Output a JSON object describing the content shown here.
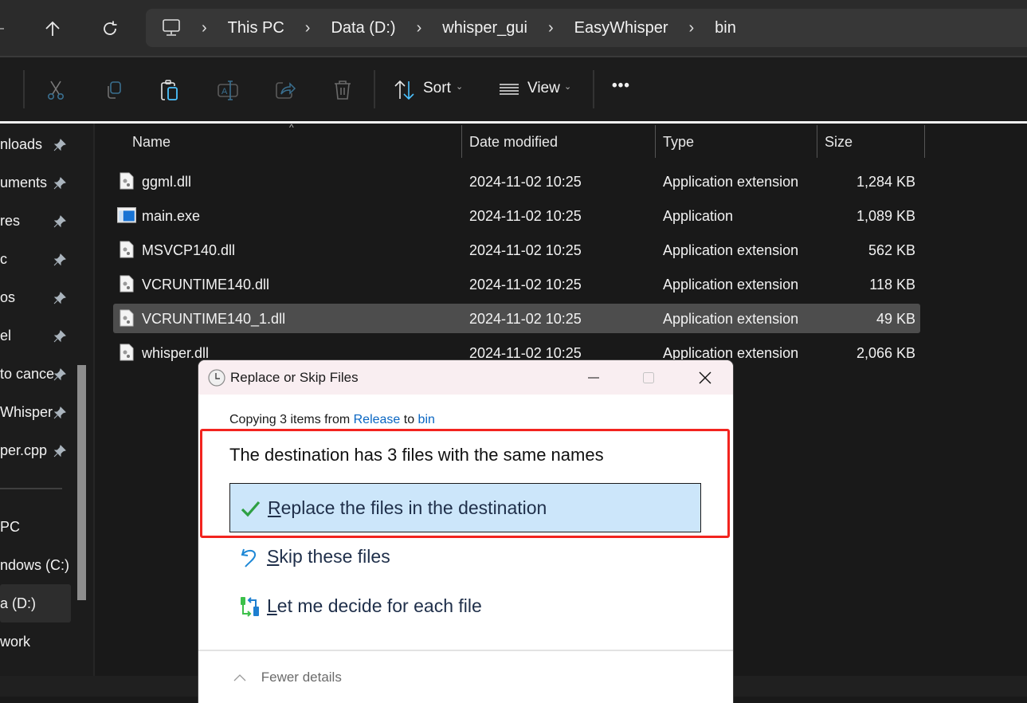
{
  "address_bar": {
    "breadcrumbs": [
      "This PC",
      "Data (D:)",
      "whisper_gui",
      "EasyWhisper",
      "bin"
    ],
    "icons": {
      "up": "arrow-up-icon",
      "refresh": "refresh-icon",
      "root": "computer-icon"
    }
  },
  "command_bar": {
    "icons": [
      "cut-icon",
      "copy-icon",
      "paste-icon",
      "rename-icon",
      "share-icon",
      "delete-icon"
    ],
    "sort_label": "Sort",
    "view_label": "View",
    "more_label": "•••"
  },
  "sidebar": {
    "pinned": [
      {
        "label": "nloads"
      },
      {
        "label": "uments"
      },
      {
        "label": "res"
      },
      {
        "label": "c"
      },
      {
        "label": "os"
      },
      {
        "label": "el"
      },
      {
        "label": "to cance"
      },
      {
        "label": "Whisper"
      },
      {
        "label": "per.cpp"
      }
    ],
    "drives": [
      {
        "label": "PC"
      },
      {
        "label": "ndows (C:)"
      },
      {
        "label": "a (D:)",
        "selected": true
      },
      {
        "label": "work"
      }
    ]
  },
  "file_list": {
    "columns": {
      "name": "Name",
      "date": "Date modified",
      "type": "Type",
      "size": "Size"
    },
    "sort_indicator": "^",
    "rows": [
      {
        "name": "ggml.dll",
        "date": "2024-11-02 10:25",
        "type": "Application extension",
        "size": "1,284 KB",
        "icon": "dll-file-icon"
      },
      {
        "name": "main.exe",
        "date": "2024-11-02 10:25",
        "type": "Application",
        "size": "1,089 KB",
        "icon": "exe-file-icon"
      },
      {
        "name": "MSVCP140.dll",
        "date": "2024-11-02 10:25",
        "type": "Application extension",
        "size": "562 KB",
        "icon": "dll-file-icon"
      },
      {
        "name": "VCRUNTIME140.dll",
        "date": "2024-11-02 10:25",
        "type": "Application extension",
        "size": "118 KB",
        "icon": "dll-file-icon"
      },
      {
        "name": "VCRUNTIME140_1.dll",
        "date": "2024-11-02 10:25",
        "type": "Application extension",
        "size": "49 KB",
        "icon": "dll-file-icon",
        "selected": true
      },
      {
        "name": "whisper.dll",
        "date": "2024-11-02 10:25",
        "type": "Application extension",
        "size": "2,066 KB",
        "icon": "dll-file-icon"
      }
    ]
  },
  "dialog": {
    "title": "Replace or Skip Files",
    "copy_prefix": "Copying 3 items from ",
    "copy_source": "Release",
    "copy_mid": " to ",
    "copy_dest": "bin",
    "headline": "The destination has 3 files with the same names",
    "options": [
      {
        "accel": "R",
        "rest": "eplace the files in the destination",
        "icon": "checkmark-icon",
        "active": true
      },
      {
        "accel": "S",
        "rest": "kip these files",
        "icon": "undo-arrow-icon"
      },
      {
        "accel": "L",
        "rest": "et me decide for each file",
        "icon": "compare-files-icon"
      }
    ],
    "fewer_details": "Fewer details",
    "colors": {
      "highlight": "#f2241f",
      "selected_option": "#cce6fa",
      "link": "#0a66c2"
    }
  }
}
